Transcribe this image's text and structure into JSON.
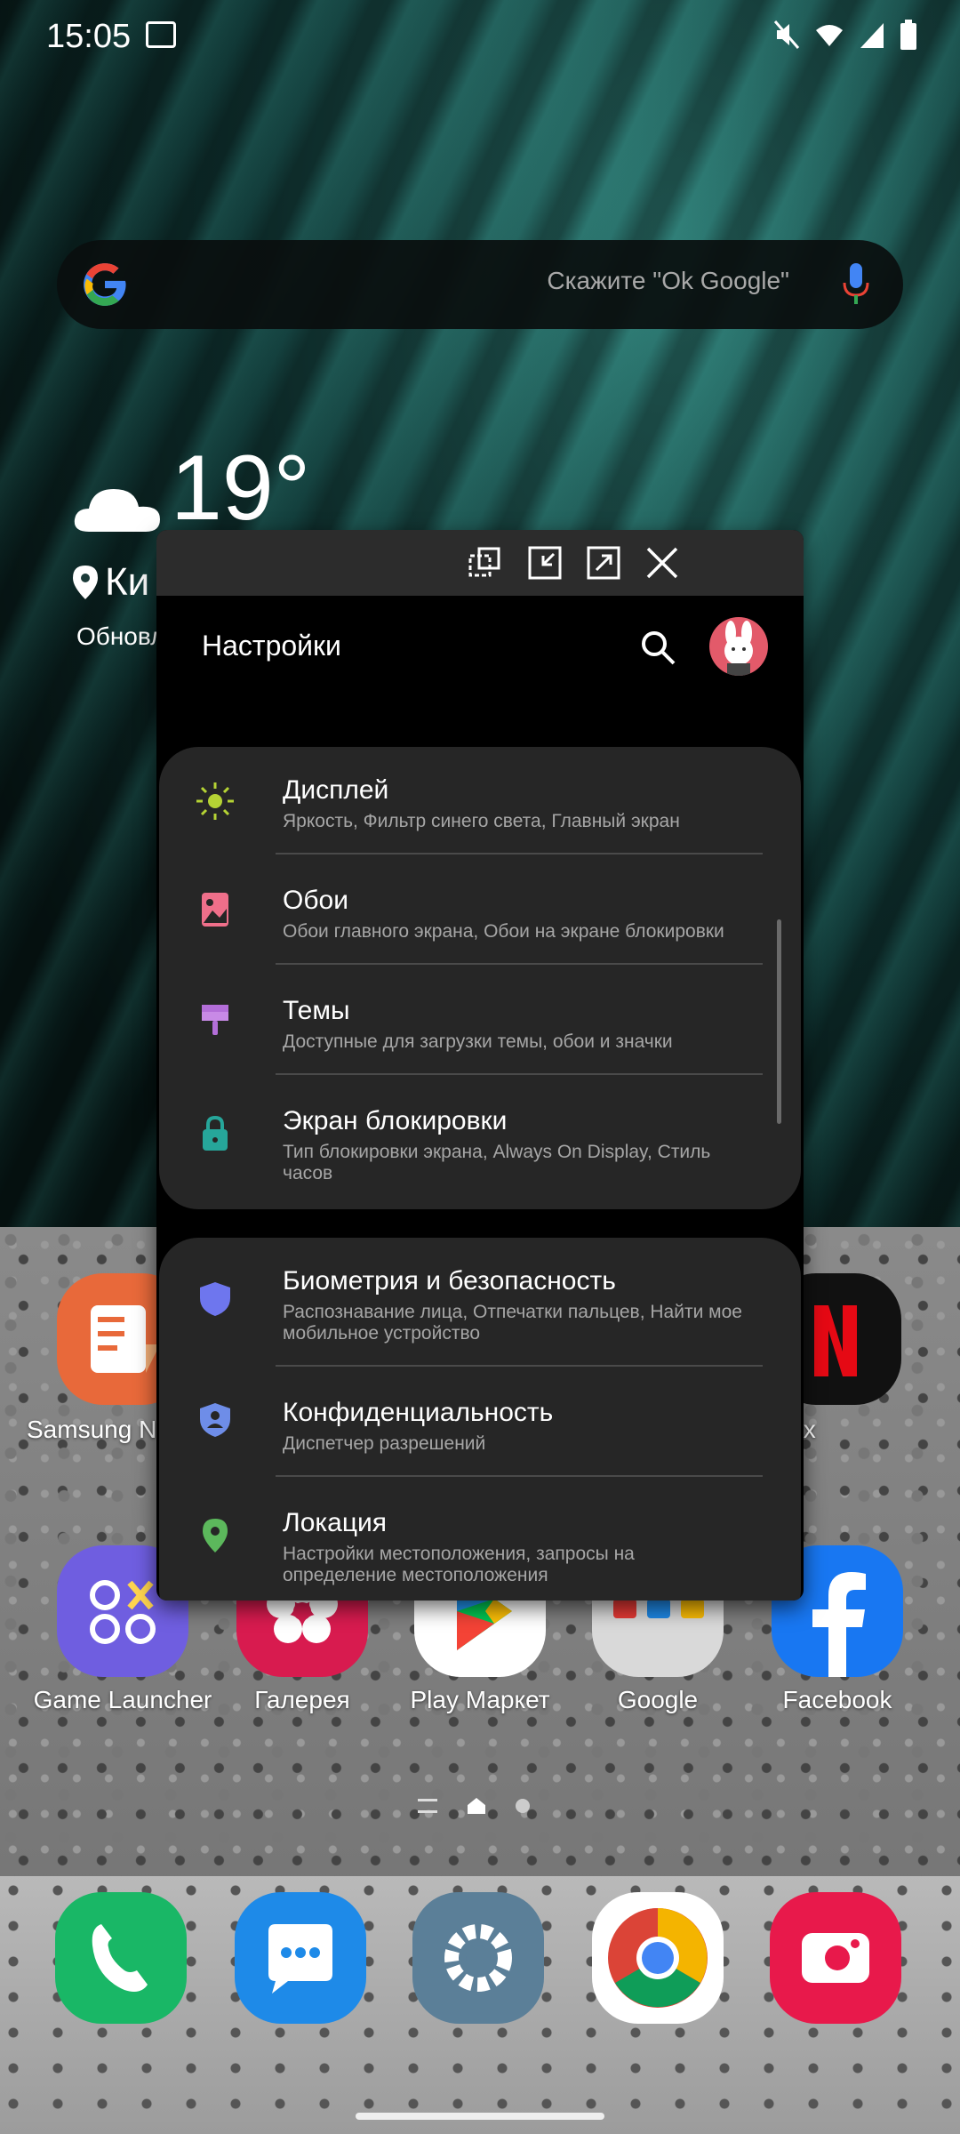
{
  "status_bar": {
    "time": "15:05",
    "icons": [
      "image-icon",
      "mute-icon",
      "wifi-icon",
      "signal-icon",
      "battery-icon"
    ]
  },
  "search_widget": {
    "hint": "Скажите \"Ok Google\"",
    "icons": [
      "google-logo-icon",
      "microphone-icon"
    ]
  },
  "weather": {
    "temperature": "19°",
    "city": "Ки",
    "updated": "Обновл"
  },
  "apps_row1": [
    {
      "label": "Samsung N",
      "color": "#e8693a"
    },
    {
      "label": "Netflix",
      "color": "#111111"
    }
  ],
  "apps_row2": [
    {
      "label": "Game Launcher",
      "color": "#6f5ee0"
    },
    {
      "label": "Галерея",
      "color": "#d81b4f"
    },
    {
      "label": "Play Маркет",
      "color": "#ffffff"
    },
    {
      "label": "Google",
      "color": "#d9d9d9"
    },
    {
      "label": "Facebook",
      "color": "#1877f2"
    }
  ],
  "dock": [
    {
      "name": "phone",
      "color": "#19b766"
    },
    {
      "name": "messages",
      "color": "#1e8ae8"
    },
    {
      "name": "settings",
      "color": "#5b7f98"
    },
    {
      "name": "chrome",
      "color": "#ffffff"
    },
    {
      "name": "camera",
      "color": "#e8194b"
    }
  ],
  "popup": {
    "toolbar_icons": [
      "split-screen-icon",
      "minimize-icon",
      "maximize-icon",
      "close-icon"
    ],
    "title": "Настройки",
    "groups": [
      {
        "items": [
          {
            "title": "Дисплей",
            "subtitle": "Яркость, Фильтр синего света, Главный экран",
            "icon": "sun-icon",
            "color": "#b5d334"
          },
          {
            "title": "Обои",
            "subtitle": "Обои главного экрана, Обои на экране блокировки",
            "icon": "wallpaper-icon",
            "color": "#ef6f8a"
          },
          {
            "title": "Темы",
            "subtitle": "Доступные для загрузки темы, обои и значки",
            "icon": "paintbrush-icon",
            "color": "#b36ed8"
          },
          {
            "title": "Экран блокировки",
            "subtitle": "Тип блокировки экрана, Always On Display, Стиль часов",
            "icon": "lock-icon",
            "color": "#26a69a"
          }
        ]
      },
      {
        "items": [
          {
            "title": "Биометрия и безопасность",
            "subtitle": "Распознавание лица, Отпечатки пальцев, Найти мое мобильное устройство",
            "icon": "shield-icon",
            "color": "#6e76ee"
          },
          {
            "title": "Конфиденциальность",
            "subtitle": "Диспетчер разрешений",
            "icon": "privacy-icon",
            "color": "#6e8de8"
          },
          {
            "title": "Локация",
            "subtitle": "Настройки местоположения, запросы на определение местоположения",
            "icon": "location-icon",
            "color": "#5cb85c"
          }
        ]
      }
    ]
  }
}
